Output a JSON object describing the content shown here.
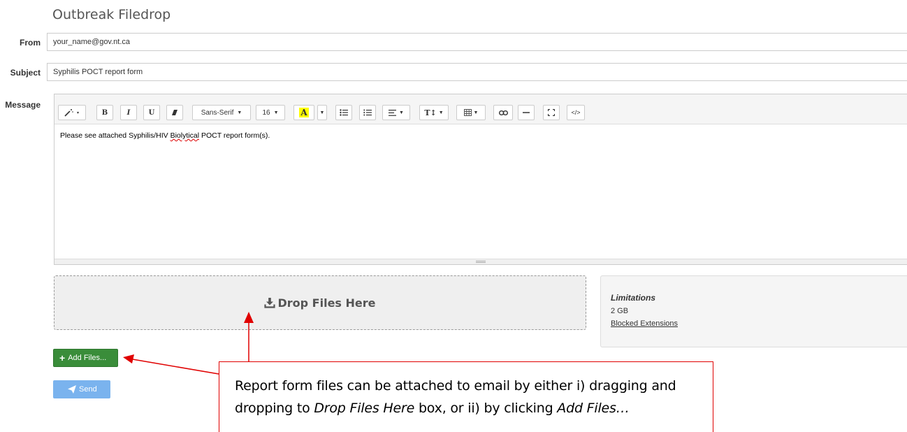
{
  "page": {
    "title": "Outbreak Filedrop"
  },
  "form": {
    "from_label": "From",
    "from_value": "your_name@gov.nt.ca",
    "subject_label": "Subject",
    "subject_value": "Syphilis POCT report form",
    "message_label": "Message"
  },
  "toolbar": {
    "font_family": "Sans-Serif",
    "font_size": "16",
    "bold": "B",
    "italic": "I",
    "underline": "U",
    "color_letter": "A",
    "code": "</>"
  },
  "editor": {
    "text_before": "Please see attached Syphilis/HIV ",
    "misspelled": "Biolytical",
    "text_after": " POCT report form(s)."
  },
  "dropzone": {
    "label": "Drop Files Here"
  },
  "limitations": {
    "title": "Limitations",
    "size": "2 GB",
    "blocked_link": "Blocked Extensions"
  },
  "buttons": {
    "add_files": "Add Files...",
    "send": "Send"
  },
  "callout": {
    "part1": "Report form files can be attached to email by either i) dragging and dropping to ",
    "emph1": "Drop Files Here",
    "part2": " box, or ii) by clicking ",
    "emph2": "Add Files…"
  },
  "colors": {
    "add_button": "#3a8d3a",
    "send_button": "#7ab3ee",
    "annotation": "#e00000",
    "highlight": "#ffff00"
  }
}
